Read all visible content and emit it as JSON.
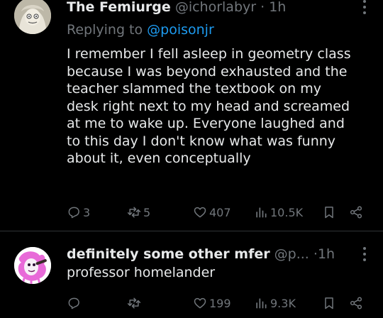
{
  "tweets": [
    {
      "display_name": "The Femiurge",
      "handle": "@ichorlabyr",
      "dot": "·",
      "time": "1h",
      "replying_prefix": "Replying to ",
      "replying_to": "@poisonjr",
      "body_lines": [
        "I remember I fell asleep in geometry class",
        "because I was beyond exhausted and the",
        "teacher slammed the textbook on my",
        "desk right next to my head and screamed",
        "at me to wake up. Everyone laughed and",
        "to this day I don't know what was funny",
        "about it, even conceptually"
      ],
      "replies": "3",
      "reposts": "5",
      "likes": "407",
      "views": "10.5K"
    },
    {
      "display_name": "definitely some other mfer",
      "handle": "@p...",
      "dot": "·",
      "time": "1h",
      "body_lines": [
        "professor homelander"
      ],
      "replies": "",
      "reposts": "",
      "likes": "199",
      "views": "9.3K"
    }
  ],
  "colors": {
    "background": "#000000",
    "text": "#e7e9ea",
    "muted": "#71767b",
    "link": "#1d9bf0",
    "divider": "#2f3336"
  },
  "icons": [
    "reply-icon",
    "retweet-icon",
    "like-icon",
    "views-icon",
    "bookmark-icon",
    "share-icon",
    "more-icon"
  ]
}
